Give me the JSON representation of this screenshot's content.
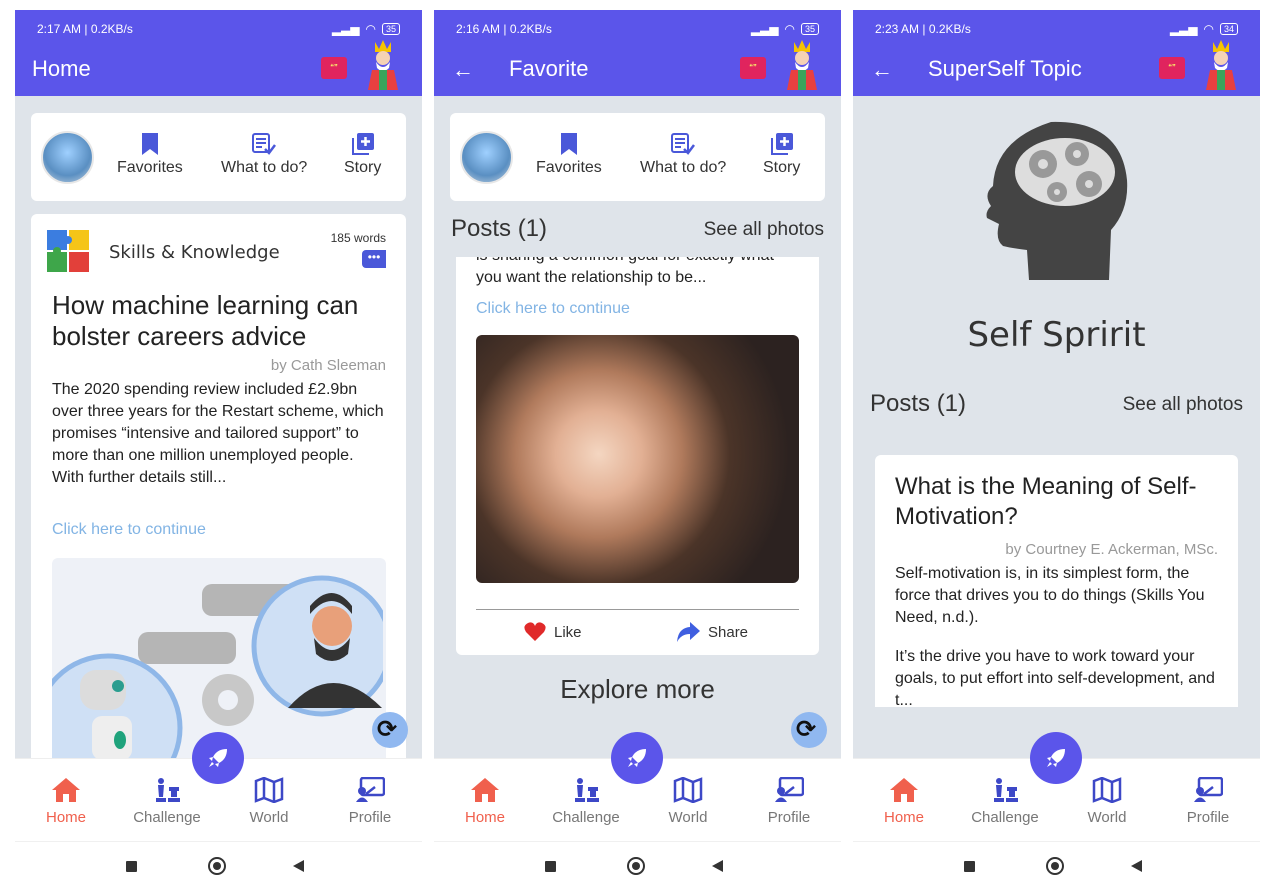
{
  "screens": {
    "home": {
      "status": {
        "time": "2:17 AM | 0.2KB/s",
        "extra": "…",
        "battery": "35"
      },
      "title": "Home",
      "toolbar": {
        "favorites": "Favorites",
        "what_to_do": "What to do?",
        "story": "Story"
      },
      "category": {
        "title": "Skills & Knowledge",
        "words": "185 words",
        "tag": "•••"
      },
      "article": {
        "title": "How machine learning can bolster careers advice",
        "byline": "by Cath Sleeman",
        "excerpt": "The 2020 spending review included £2.9bn over three years for the Restart scheme, which promises “intensive and tailored support” to more than one million unemployed people. With further details still...",
        "continue": "Click here to continue"
      }
    },
    "favorite": {
      "status": {
        "time": "2:16 AM | 0.2KB/s",
        "extra": "…",
        "battery": "35"
      },
      "title": "Favorite",
      "toolbar": {
        "favorites": "Favorites",
        "what_to_do": "What to do?",
        "story": "Story"
      },
      "posts": {
        "heading": "Posts (1)",
        "see_all": "See all photos"
      },
      "post": {
        "excerpt": "is sharing a common goal for exactly what you want the relationship to be...",
        "continue": "Click here to continue",
        "like": "Like",
        "share": "Share"
      },
      "explore": "Explore more"
    },
    "topic": {
      "status": {
        "time": "2:23 AM | 0.2KB/s",
        "extra": "…",
        "battery": "34"
      },
      "title": "SuperSelf Topic",
      "topic_name": "Self Spririt",
      "posts": {
        "heading": "Posts (1)",
        "see_all": "See all photos"
      },
      "post": {
        "title": "What is the Meaning of Self-Motivation?",
        "byline": "by Courtney E. Ackerman, MSc.",
        "para1": "Self-motivation is, in its simplest form, the force that drives you to do things (Skills You Need, n.d.).",
        "para2": "It’s the drive you have to work toward your goals, to put effort into self-development, and t..."
      }
    }
  },
  "nav": {
    "home": "Home",
    "challenge": "Challenge",
    "world": "World",
    "profile": "Profile"
  },
  "colors": {
    "primary": "#5b55ea",
    "active_nav": "#f0604d",
    "link": "#82b4e4",
    "background": "#dfe4ea"
  }
}
